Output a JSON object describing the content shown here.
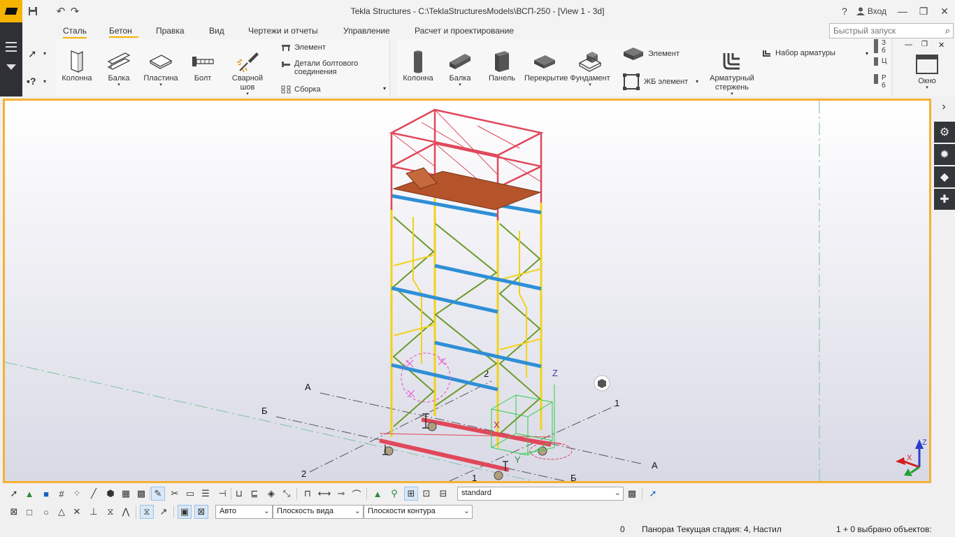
{
  "window": {
    "title": "Tekla Structures - C:\\TeklaStructuresModels\\ВСП-250  - [View 1 - 3d]",
    "login_label": "Вход"
  },
  "tabs": [
    {
      "label": "Сталь",
      "active": true
    },
    {
      "label": "Бетон",
      "active": false
    },
    {
      "label": "Правка",
      "active": false
    },
    {
      "label": "Вид",
      "active": false
    },
    {
      "label": "Чертежи и отчеты",
      "active": false
    },
    {
      "label": "Управление",
      "active": false
    },
    {
      "label": "Расчет и проектирование",
      "active": false
    }
  ],
  "quick_launch": {
    "placeholder": "Быстрый запуск"
  },
  "ribbon": {
    "steel": {
      "column": "Колонна",
      "beam": "Балка",
      "plate": "Пластина",
      "bolt": "Болт",
      "weld": "Сварной шов",
      "element": "Элемент",
      "bolt_details": "Детали болтового соединения",
      "assembly": "Сборка"
    },
    "concrete": {
      "column": "Колонна",
      "beam": "Балка",
      "panel": "Панель",
      "slab": "Перекрытие",
      "footing": "Фундамент",
      "element": "Элемент",
      "rc_element": "ЖБ элемент",
      "rebar": "Арматурный стержень",
      "rebar_set": "Набор арматуры",
      "clip_1": "З б",
      "clip_2": "Ц",
      "clip_3": "Р б"
    },
    "window": "Окно"
  },
  "viewport": {
    "grid_labels": {
      "a_left": "А",
      "b_left": "Б",
      "two_left": "2",
      "two_top": "2",
      "one_right": "1",
      "a_right": "А",
      "one_bottom": "1",
      "b_bottom": "Б"
    },
    "axes": {
      "z": "Z",
      "x": "X",
      "y": "Y"
    }
  },
  "bottom_toolbar": {
    "filter_value": "standard",
    "snap_mode": "Авто",
    "plane_value": "Плоскость вида",
    "contour_value": "Плоскости контура"
  },
  "status": {
    "count": "0",
    "mode": "Панорам",
    "phase": "Текущая стадия: 4, Настил",
    "selection": "1 + 0 выбрано объектов:"
  },
  "colors": {
    "accent": "#f5b400",
    "viewport_border": "#f5b133"
  }
}
